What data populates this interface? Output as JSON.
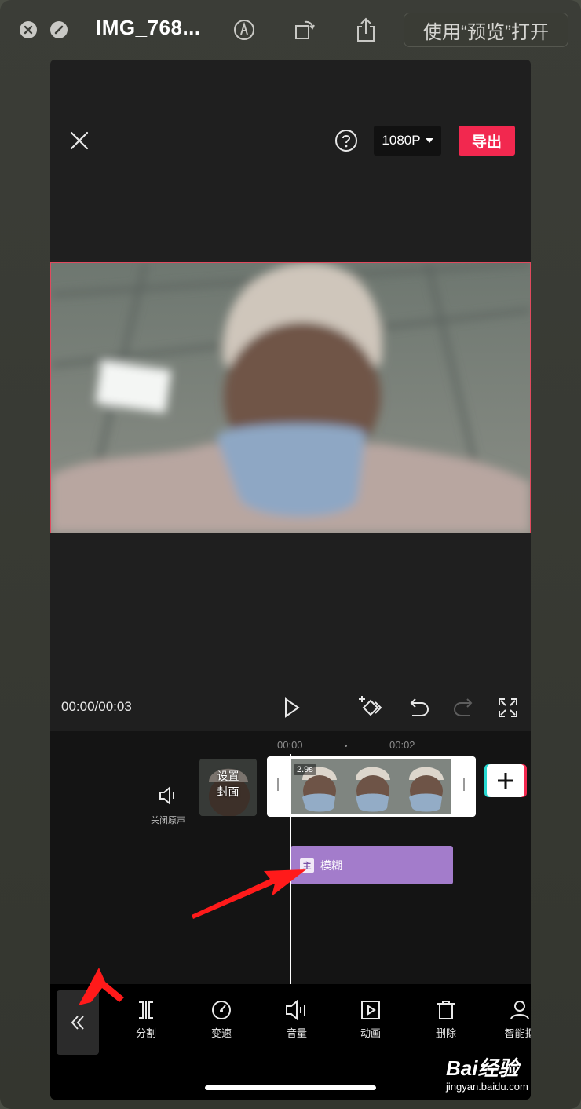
{
  "quicklook": {
    "title": "IMG_768...",
    "open_with": "使用“预览”打开"
  },
  "editor": {
    "resolution": "1080P",
    "export_label": "导出",
    "timecode": "00:00/00:03",
    "ruler": {
      "t0": "00:00",
      "t1": "00:02"
    },
    "mute_label": "关闭原声",
    "cover_label_line1": "设置",
    "cover_label_line2": "封面",
    "clip_duration": "2.9s",
    "effect": {
      "tag": "主",
      "label": "模糊"
    },
    "tools": [
      {
        "label": "分割",
        "icon": "split-icon"
      },
      {
        "label": "变速",
        "icon": "speed-icon"
      },
      {
        "label": "音量",
        "icon": "volume-icon"
      },
      {
        "label": "动画",
        "icon": "animation-icon"
      },
      {
        "label": "删除",
        "icon": "delete-icon"
      },
      {
        "label": "智能抠",
        "icon": "smart-cutout-icon"
      }
    ]
  },
  "watermark": {
    "brand": "Bai经验",
    "url": "jingyan.baidu.com"
  },
  "colors": {
    "accent": "#f2284f",
    "effect": "#a37ccb",
    "annotation": "#ff1a1a"
  }
}
